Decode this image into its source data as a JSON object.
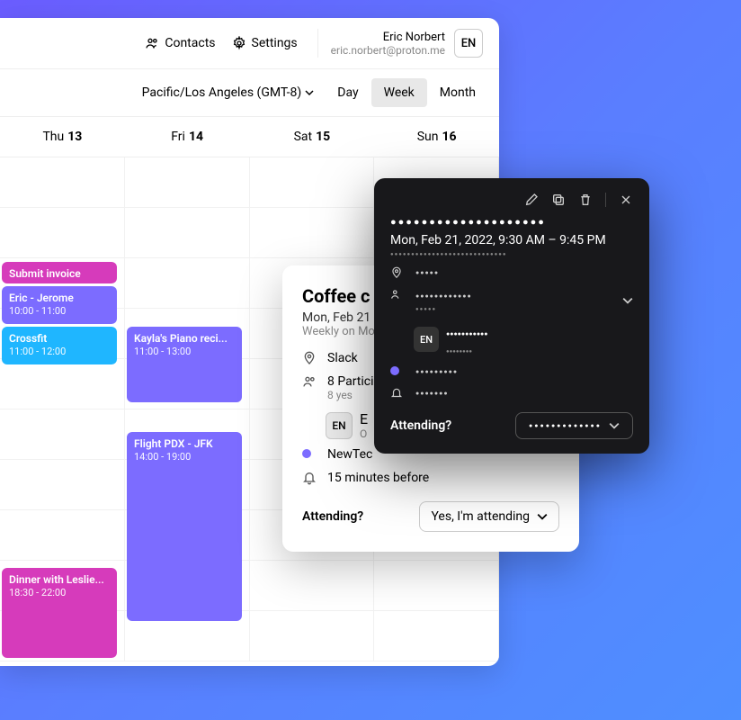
{
  "toolbar": {
    "contacts": "Contacts",
    "settings": "Settings"
  },
  "user": {
    "name": "Eric Norbert",
    "email": "eric.norbert@proton.me",
    "initials": "EN"
  },
  "timezone": "Pacific/Los Angeles (GMT-8)",
  "views": {
    "day": "Day",
    "week": "Week",
    "month": "Month",
    "active": "Week"
  },
  "days": [
    {
      "label": "Thu",
      "num": "13"
    },
    {
      "label": "Fri",
      "num": "14"
    },
    {
      "label": "Sat",
      "num": "15"
    },
    {
      "label": "Sun",
      "num": "16"
    }
  ],
  "events": {
    "invoice": {
      "title": "Submit invoice",
      "time": "",
      "color": "#d63bbb"
    },
    "ericj": {
      "title": "Eric - Jerome",
      "time": "10:00 - 11:00",
      "color": "#7c6cff"
    },
    "crossfit": {
      "title": "Crossfit",
      "time": "11:00 - 12:00",
      "color": "#1fb6ff"
    },
    "piano": {
      "title": "Kayla's Piano reci...",
      "time": "11:00 - 13:00",
      "color": "#7c6cff"
    },
    "flight": {
      "title": "Flight PDX - JFK",
      "time": "14:00 - 19:00",
      "color": "#7c6cff"
    },
    "dinner": {
      "title": "Dinner with Leslie...",
      "time": "18:30 - 22:00",
      "color": "#d63bbb"
    }
  },
  "popup_light": {
    "title": "Coffee c",
    "date": "Mon, Feb 21",
    "recur": "Weekly on Mo",
    "location": "Slack",
    "participants": "8 Partici",
    "participants_sub": "8 yes",
    "organizer_initials": "EN",
    "organizer_name": "E",
    "organizer_sub": "O",
    "calendar": "NewTec",
    "calendar_color": "#7c6cff",
    "reminder": "15 minutes before",
    "attending_label": "Attending?",
    "attending_value": "Yes, I'm attending"
  },
  "popup_dark": {
    "title_dots": "●●●●●●●●●●●●●●●●●●●●",
    "date": "Mon, Feb 21, 2022, 9:30 AM – 9:45 PM",
    "recur_dots": "●●●●●●●●●●●●●●●●●●●●●●●●●●●●",
    "location_dots": "●●●●●",
    "participants_dots": "●●●●●●●●●●●●",
    "participants_sub_dots": "●●●●●",
    "organizer_initials": "EN",
    "organizer_name_dots": "●●●●●●●●●●●",
    "organizer_sub_dots": "●●●●●●●●",
    "calendar_dots": "●●●●●●●●●",
    "calendar_color": "#7c6cff",
    "reminder_dots": "●●●●●●●",
    "attending_label": "Attending?",
    "attending_value_dots": "●●●●●●●●●●●●●"
  }
}
